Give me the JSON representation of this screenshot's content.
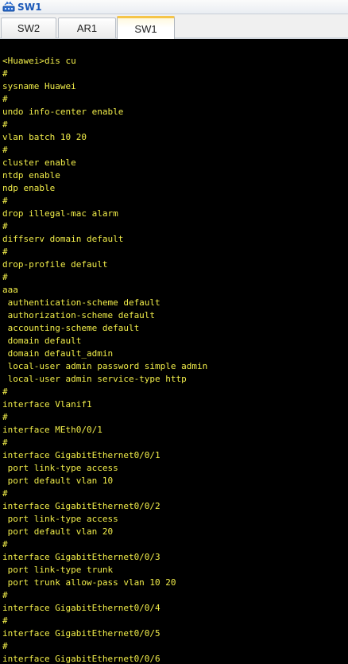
{
  "window": {
    "title": "SW1",
    "icon": "network-switch-icon"
  },
  "tabs": [
    {
      "label": "SW2",
      "active": false
    },
    {
      "label": "AR1",
      "active": false
    },
    {
      "label": "SW1",
      "active": true
    }
  ],
  "colors": {
    "terminal_background": "#000000",
    "terminal_text": "#f2ee4a",
    "title_text": "#1a58b8",
    "active_tab_accent": "#f5c54a"
  },
  "terminal": {
    "lines": [
      "<Huawei>dis cu",
      "#",
      "sysname Huawei",
      "#",
      "undo info-center enable",
      "#",
      "vlan batch 10 20",
      "#",
      "cluster enable",
      "ntdp enable",
      "ndp enable",
      "#",
      "drop illegal-mac alarm",
      "#",
      "diffserv domain default",
      "#",
      "drop-profile default",
      "#",
      "aaa",
      " authentication-scheme default",
      " authorization-scheme default",
      " accounting-scheme default",
      " domain default",
      " domain default_admin",
      " local-user admin password simple admin",
      " local-user admin service-type http",
      "#",
      "interface Vlanif1",
      "#",
      "interface MEth0/0/1",
      "#",
      "interface GigabitEthernet0/0/1",
      " port link-type access",
      " port default vlan 10",
      "#",
      "interface GigabitEthernet0/0/2",
      " port link-type access",
      " port default vlan 20",
      "#",
      "interface GigabitEthernet0/0/3",
      " port link-type trunk",
      " port trunk allow-pass vlan 10 20",
      "#",
      "interface GigabitEthernet0/0/4",
      "#",
      "interface GigabitEthernet0/0/5",
      "#",
      "interface GigabitEthernet0/0/6"
    ]
  }
}
